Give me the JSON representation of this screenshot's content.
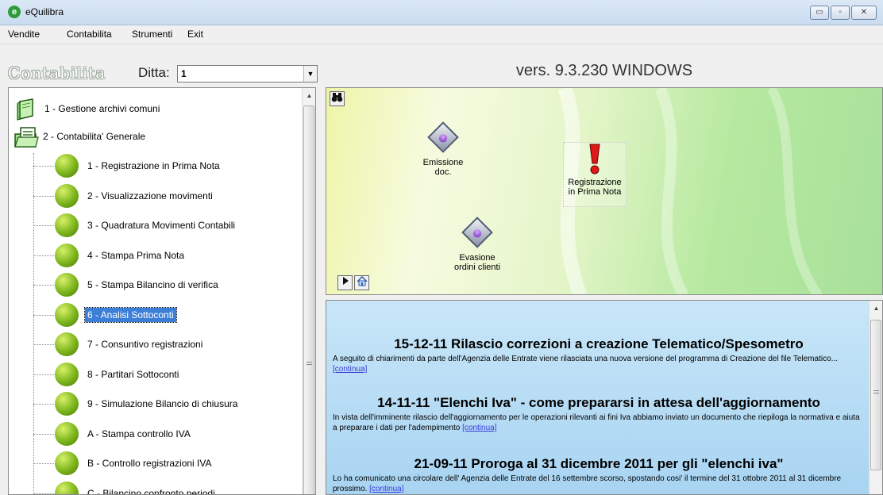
{
  "window": {
    "title": "eQuilibra",
    "icon": "e-leaf-icon",
    "controls": {
      "minimize": "▭",
      "maximize": "▫",
      "close": "✕"
    }
  },
  "menu": [
    "Vendite",
    "Contabilita",
    "Strumenti",
    "Exit"
  ],
  "header": {
    "section_title": "Contabilita",
    "ditta_label": "Ditta:",
    "ditta_value": "1",
    "version": "vers. 9.3.230 WINDOWS"
  },
  "tree": {
    "roots": [
      {
        "label": "1 - Gestione archivi comuni",
        "icon": "folder-closed-icon"
      },
      {
        "label": "2 - Contabilita' Generale",
        "icon": "folder-open-icon"
      }
    ],
    "children": [
      {
        "label": "1 - Registrazione in Prima Nota",
        "selected": false
      },
      {
        "label": "2 - Visualizzazione movimenti",
        "selected": false
      },
      {
        "label": "3 - Quadratura Movimenti Contabili",
        "selected": false
      },
      {
        "label": "4 - Stampa Prima Nota",
        "selected": false
      },
      {
        "label": "5 - Stampa Bilancino di verifica",
        "selected": false
      },
      {
        "label": "6 - Analisi Sottoconti",
        "selected": true
      },
      {
        "label": "7 - Consuntivo registrazioni",
        "selected": false
      },
      {
        "label": "8 - Partitari Sottoconti",
        "selected": false
      },
      {
        "label": "9 - Simulazione Bilancio di chiusura",
        "selected": false
      },
      {
        "label": "A - Stampa controllo IVA",
        "selected": false
      },
      {
        "label": "B - Controllo registrazioni IVA",
        "selected": false
      },
      {
        "label": "C - Bilancino confronto periodi",
        "selected": false
      }
    ]
  },
  "map": {
    "nodes": [
      {
        "line1": "Emissione",
        "line2": "doc.",
        "icon": "process-diamond-icon"
      },
      {
        "line1": "Registrazione",
        "line2": "in Prima Nota",
        "icon": "exclamation-icon"
      },
      {
        "line1": "Evasione",
        "line2": "ordini clienti",
        "icon": "process-diamond-icon"
      }
    ],
    "buttons": {
      "search": "binoculars-icon",
      "play": "play-icon",
      "home": "home-icon"
    }
  },
  "news": [
    {
      "title": "15-12-11 Rilascio correzioni a creazione Telematico/Spesometro",
      "body": "A seguito di chiarimenti da parte dell'Agenzia delle Entrate viene rilasciata una nuova versione del programma di Creazione del file Telematico... ",
      "link": "[continua]"
    },
    {
      "title": "14-11-11 \"Elenchi Iva\" - come prepararsi in attesa dell'aggiornamento",
      "body": "In vista dell'imminente rilascio dell'aggiornamento per le operazioni rilevanti ai fini Iva abbiamo inviato un documento che riepiloga la normativa e aiuta a preparare i dati per l'adempimento ",
      "link": "[continua]"
    },
    {
      "title": "21-09-11 Proroga al 31 dicembre 2011 per gli \"elenchi iva\"",
      "body": "Lo ha comunicato una circolare dell' Agenzia delle Entrate del 16 settembre scorso, spostando cosi' il termine del 31 ottobre 2011 al 31 dicembre prossimo. ",
      "link": "[continua]"
    }
  ]
}
